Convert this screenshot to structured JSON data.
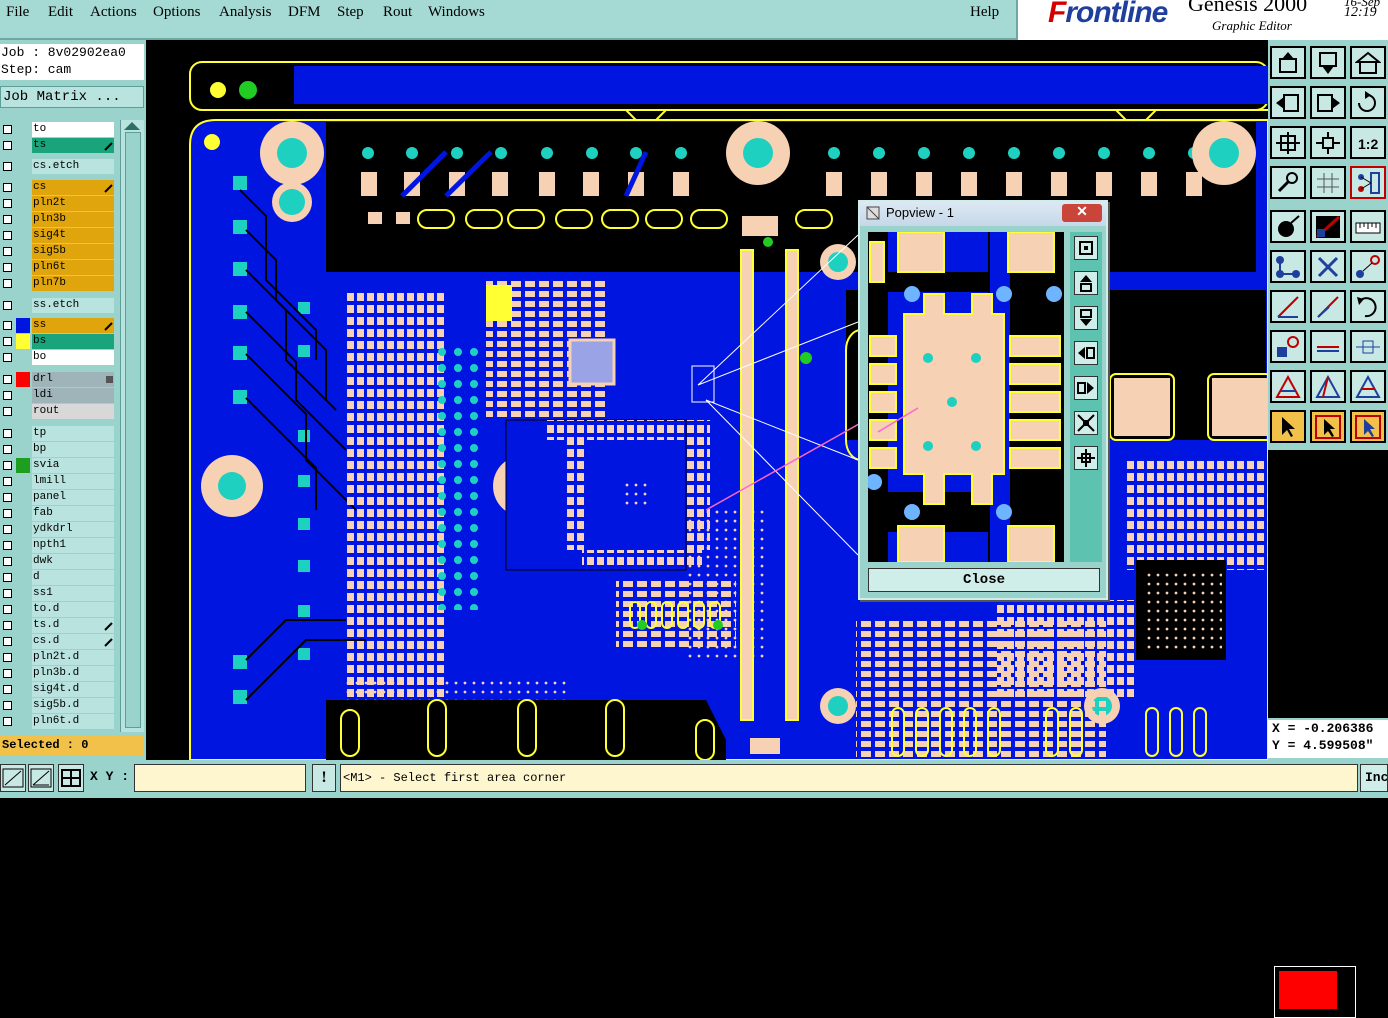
{
  "menu": {
    "items": [
      "File",
      "Edit",
      "Actions",
      "Options",
      "Analysis",
      "DFM",
      "Step",
      "Rout",
      "Windows"
    ],
    "help": "Help"
  },
  "brand": {
    "logo_initial": "F",
    "logo_rest": "rontline",
    "product": "Genesis 2000",
    "subtitle": "Graphic Editor",
    "date": "16-Sep",
    "time": "12:19"
  },
  "job": {
    "job_line": "Job : 8v02902ea0",
    "step_line": "Step: cam"
  },
  "job_matrix_label": "Job Matrix ...",
  "layers": [
    {
      "name": "to",
      "bg": "#ffffff",
      "marker": ""
    },
    {
      "name": "ts",
      "bg": "#1aa47c",
      "marker": "edit"
    },
    {
      "name": "cs.etch",
      "bg": "#b9e3de",
      "marker": ""
    },
    {
      "name": "cs",
      "bg": "#e0a50c",
      "marker": "edit"
    },
    {
      "name": "pln2t",
      "bg": "#e0a50c",
      "marker": ""
    },
    {
      "name": "pln3b",
      "bg": "#e0a50c",
      "marker": ""
    },
    {
      "name": "sig4t",
      "bg": "#e0a50c",
      "marker": ""
    },
    {
      "name": "sig5b",
      "bg": "#e0a50c",
      "marker": ""
    },
    {
      "name": "pln6t",
      "bg": "#e0a50c",
      "marker": ""
    },
    {
      "name": "pln7b",
      "bg": "#e0a50c",
      "marker": ""
    },
    {
      "name": "ss.etch",
      "bg": "#b9e3de",
      "marker": ""
    },
    {
      "name": "ss",
      "bg": "#e0a50c",
      "marker": "edit",
      "color": "#0015e0"
    },
    {
      "name": "bs",
      "bg": "#1aa47c",
      "marker": "",
      "color": "#ffff33"
    },
    {
      "name": "bo",
      "bg": "#ffffff",
      "marker": ""
    },
    {
      "name": "drl",
      "bg": "#9fb4b8",
      "marker": "grid",
      "color": "#ff0000"
    },
    {
      "name": "ldi",
      "bg": "#9fb4b8",
      "marker": ""
    },
    {
      "name": "rout",
      "bg": "#d8d8d8",
      "marker": ""
    },
    {
      "name": "tp",
      "bg": "#b9e3de",
      "marker": ""
    },
    {
      "name": "bp",
      "bg": "#b9e3de",
      "marker": ""
    },
    {
      "name": "svia",
      "bg": "#b9e3de",
      "marker": "",
      "color": "#1e9e1e"
    },
    {
      "name": "lmill",
      "bg": "#b9e3de",
      "marker": ""
    },
    {
      "name": "panel",
      "bg": "#b9e3de",
      "marker": ""
    },
    {
      "name": "fab",
      "bg": "#b9e3de",
      "marker": ""
    },
    {
      "name": "ydkdrl",
      "bg": "#b9e3de",
      "marker": ""
    },
    {
      "name": "npth1",
      "bg": "#b9e3de",
      "marker": ""
    },
    {
      "name": "dwk",
      "bg": "#b9e3de",
      "marker": ""
    },
    {
      "name": "d",
      "bg": "#b9e3de",
      "marker": ""
    },
    {
      "name": "ss1",
      "bg": "#b9e3de",
      "marker": ""
    },
    {
      "name": "to.d",
      "bg": "#b9e3de",
      "marker": ""
    },
    {
      "name": "ts.d",
      "bg": "#b9e3de",
      "marker": "edit"
    },
    {
      "name": "cs.d",
      "bg": "#b9e3de",
      "marker": "edit"
    },
    {
      "name": "pln2t.d",
      "bg": "#b9e3de",
      "marker": ""
    },
    {
      "name": "pln3b.d",
      "bg": "#b9e3de",
      "marker": ""
    },
    {
      "name": "sig4t.d",
      "bg": "#b9e3de",
      "marker": ""
    },
    {
      "name": "sig5b.d",
      "bg": "#b9e3de",
      "marker": ""
    },
    {
      "name": "pln6t.d",
      "bg": "#b9e3de",
      "marker": ""
    }
  ],
  "selected_label": "Selected : 0",
  "popview": {
    "title": "Popview - 1",
    "close_glyph": "✕",
    "close_label": "Close"
  },
  "coords": {
    "x": "X = -0.206386",
    "y": "Y = 4.599508\""
  },
  "bottom": {
    "xy_label": "X Y :",
    "xy_value": "",
    "warn_glyph": "!",
    "prompt": "<M1> - Select first area corner",
    "inc_label": "Inc"
  },
  "colors": {
    "panel": "#9ad2cc",
    "copper": "#0015e0",
    "pad": "#f6d1b4",
    "via": "#1ed0c0",
    "outline": "#ffff33",
    "highlight": "#ffff00"
  }
}
